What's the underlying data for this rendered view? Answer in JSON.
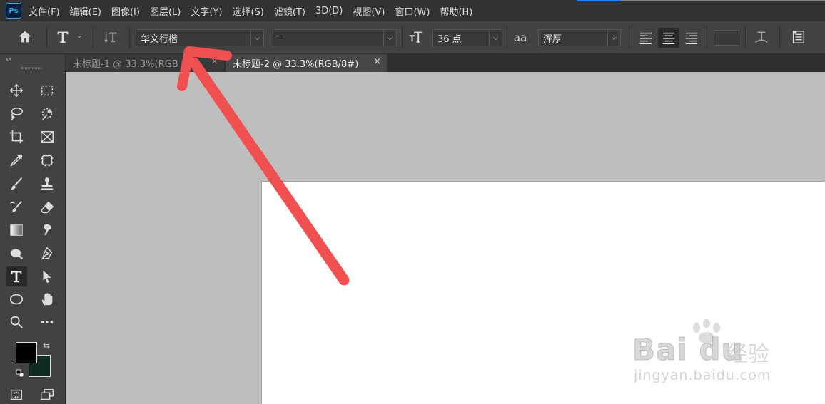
{
  "app": {
    "logo": "Ps"
  },
  "menu": {
    "items": [
      {
        "label": "文件(F)"
      },
      {
        "label": "编辑(E)"
      },
      {
        "label": "图像(I)"
      },
      {
        "label": "图层(L)"
      },
      {
        "label": "文字(Y)"
      },
      {
        "label": "选择(S)"
      },
      {
        "label": "滤镜(T)"
      },
      {
        "label": "3D(D)"
      },
      {
        "label": "视图(V)"
      },
      {
        "label": "窗口(W)"
      },
      {
        "label": "帮助(H)"
      }
    ]
  },
  "options": {
    "home_icon": "home-icon",
    "type_tool_icon": "type-tool-icon",
    "orientation_icon": "toggle-text-orientation-icon",
    "font_family": "华文行楷",
    "font_style": "-",
    "font_size_icon": "font-size-icon",
    "font_size": "36 点",
    "antialias_icon": "aa",
    "antialias": "浑厚",
    "align_left_icon": "align-left-icon",
    "align_center_icon": "align-center-icon",
    "align_right_icon": "align-right-icon",
    "warp_icon": "warp-text-icon",
    "panels_icon": "character-panel-icon",
    "text_color": "#3a3a3a"
  },
  "tabs": [
    {
      "label": "未标题-1 @ 33.3%(RGB",
      "close": "×",
      "active": false
    },
    {
      "label": "未标题-2 @ 33.3%(RGB/8#)",
      "close": "×",
      "active": true
    }
  ],
  "toolbar": {
    "collapse": "‹‹",
    "foreground_color": "#000000",
    "background_color": "#0f2a1f",
    "swap": "⇆"
  },
  "watermark": {
    "logo": "Bai du",
    "cn": "经验",
    "url": "jingyan.baidu.com"
  },
  "annotation": {
    "arrow_color": "#f05050"
  }
}
